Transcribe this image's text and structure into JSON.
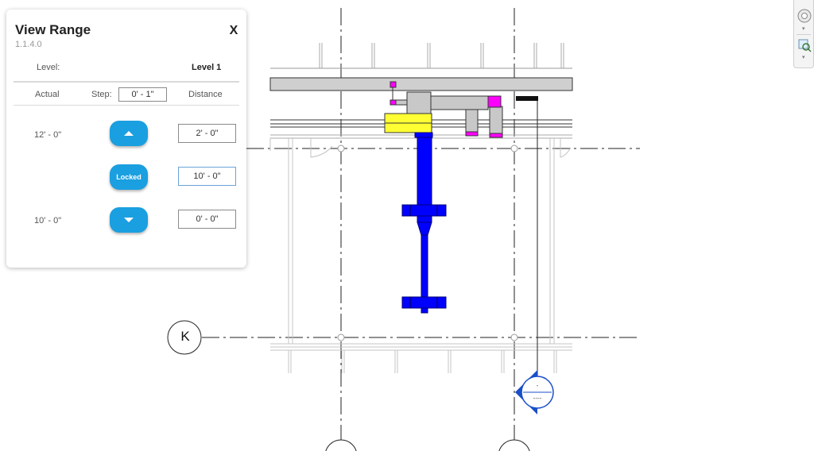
{
  "panel": {
    "title": "View Range",
    "version": "1.1.4.0",
    "close_label": "X",
    "level_label": "Level:",
    "level_value": "Level 1",
    "actual_header": "Actual",
    "step_label": "Step:",
    "step_value": "0' - 1\"",
    "distance_header": "Distance",
    "top_actual": "12' - 0\"",
    "top_distance": "2' - 0\"",
    "locked_label": "Locked",
    "middle_distance": "10' - 0\"",
    "bottom_actual": "10' - 0\"",
    "bottom_distance": "0' - 0\""
  },
  "drawing": {
    "grid_label": "K",
    "tag_top": "-",
    "tag_bottom": "----",
    "colors": {
      "duct_blue": "#0000ff",
      "magenta": "#ff00ff",
      "yellow": "#ffff33",
      "gray_fill": "#c8c8c8",
      "tag_blue": "#1a4fc9"
    }
  },
  "navbar": {
    "icons": [
      "steering-wheel-icon",
      "zoom-region-icon"
    ]
  }
}
